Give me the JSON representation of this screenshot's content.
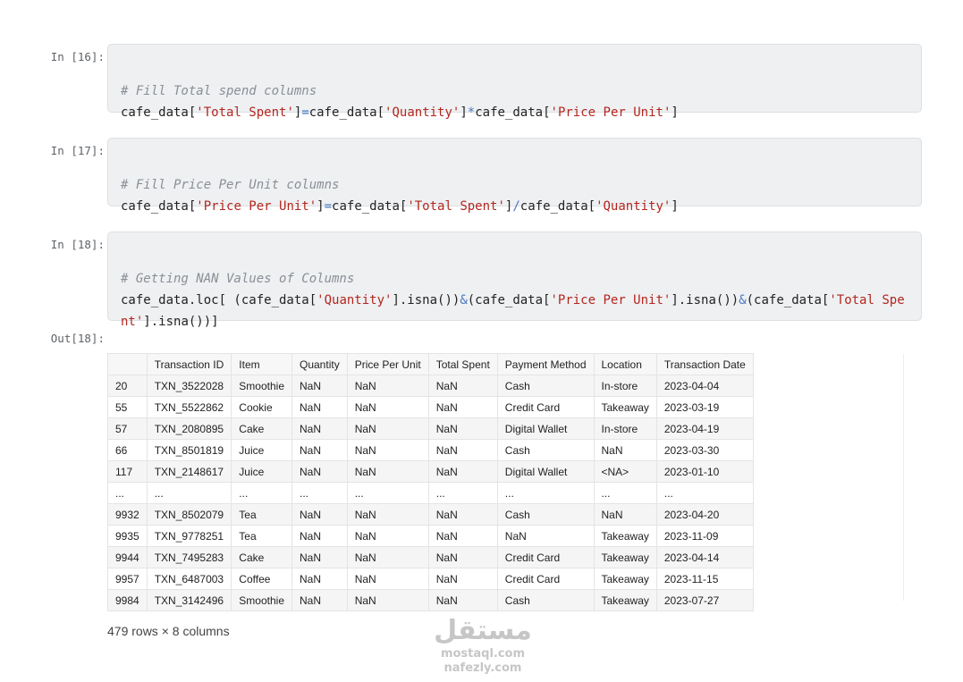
{
  "cells": [
    {
      "in_prompt": "In [16]:",
      "comment": "# Fill Total spend columns",
      "code": {
        "p1": "cafe_data[",
        "s1": "'Total Spent'",
        "p2": "]",
        "op1": "=",
        "p3": "cafe_data[",
        "s2": "'Quantity'",
        "p4": "]",
        "op2": "*",
        "p5": "cafe_data[",
        "s3": "'Price Per Unit'",
        "p6": "]"
      }
    },
    {
      "in_prompt": "In [17]:",
      "comment": "# Fill Price Per Unit columns",
      "code": {
        "p1": "cafe_data[",
        "s1": "'Price Per Unit'",
        "p2": "]",
        "op1": "=",
        "p3": "cafe_data[",
        "s2": "'Total Spent'",
        "p4": "]",
        "op2": "/",
        "p5": "cafe_data[",
        "s3": "'Quantity'",
        "p6": "]"
      }
    },
    {
      "in_prompt": "In [18]:",
      "comment": "# Getting NAN Values of Columns",
      "code": {
        "p1": "cafe_data.loc[ (cafe_data[",
        "s1": "'Quantity'",
        "p2": "].isna())",
        "op1": "&",
        "p3": "(cafe_data[",
        "s2": "'Price Per Unit'",
        "p4": "].isna())",
        "op2": "&",
        "p5": "(cafe_data[",
        "s3": "'Total Spent'",
        "p6": "].isna())]"
      },
      "out_prompt": "Out[18]:"
    }
  ],
  "table": {
    "columns": [
      "",
      "Transaction ID",
      "Item",
      "Quantity",
      "Price Per Unit",
      "Total Spent",
      "Payment Method",
      "Location",
      "Transaction Date"
    ],
    "rows": [
      [
        "20",
        "TXN_3522028",
        "Smoothie",
        "NaN",
        "NaN",
        "NaN",
        "Cash",
        "In-store",
        "2023-04-04"
      ],
      [
        "55",
        "TXN_5522862",
        "Cookie",
        "NaN",
        "NaN",
        "NaN",
        "Credit Card",
        "Takeaway",
        "2023-03-19"
      ],
      [
        "57",
        "TXN_2080895",
        "Cake",
        "NaN",
        "NaN",
        "NaN",
        "Digital Wallet",
        "In-store",
        "2023-04-19"
      ],
      [
        "66",
        "TXN_8501819",
        "Juice",
        "NaN",
        "NaN",
        "NaN",
        "Cash",
        "NaN",
        "2023-03-30"
      ],
      [
        "117",
        "TXN_2148617",
        "Juice",
        "NaN",
        "NaN",
        "NaN",
        "Digital Wallet",
        "<NA>",
        "2023-01-10"
      ],
      [
        "...",
        "...",
        "...",
        "...",
        "...",
        "...",
        "...",
        "...",
        "..."
      ],
      [
        "9932",
        "TXN_8502079",
        "Tea",
        "NaN",
        "NaN",
        "NaN",
        "Cash",
        "NaN",
        "2023-04-20"
      ],
      [
        "9935",
        "TXN_9778251",
        "Tea",
        "NaN",
        "NaN",
        "NaN",
        "NaN",
        "Takeaway",
        "2023-11-09"
      ],
      [
        "9944",
        "TXN_7495283",
        "Cake",
        "NaN",
        "NaN",
        "NaN",
        "Credit Card",
        "Takeaway",
        "2023-04-14"
      ],
      [
        "9957",
        "TXN_6487003",
        "Coffee",
        "NaN",
        "NaN",
        "NaN",
        "Credit Card",
        "Takeaway",
        "2023-11-15"
      ],
      [
        "9984",
        "TXN_3142496",
        "Smoothie",
        "NaN",
        "NaN",
        "NaN",
        "Cash",
        "Takeaway",
        "2023-07-27"
      ]
    ],
    "footer": "479 rows × 8 columns"
  },
  "watermark": {
    "logo_text": "مستقل",
    "line1": "mostaql.com",
    "line2": "nafezly.com"
  },
  "colors": {
    "cell_bg": "#eef0f2",
    "string": "#b3261e",
    "operator": "#4a78c2",
    "comment": "#8a8f96"
  }
}
